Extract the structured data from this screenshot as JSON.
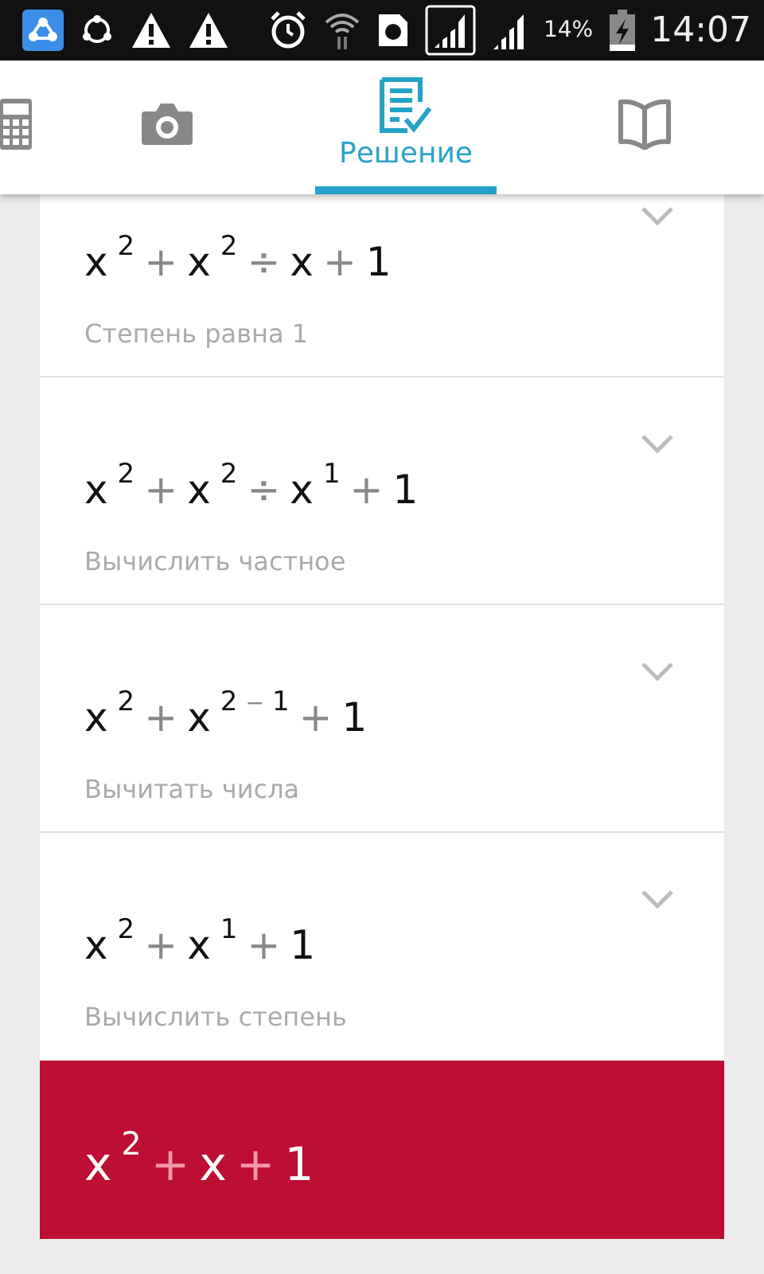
{
  "status_bar": {
    "battery": "14%",
    "time": "14:07"
  },
  "tabs": [
    {
      "kind": "calculator",
      "selected": false
    },
    {
      "kind": "camera",
      "selected": false
    },
    {
      "kind": "solution",
      "label": "Решение",
      "selected": true
    },
    {
      "kind": "book",
      "selected": false
    }
  ],
  "steps": [
    {
      "expression": [
        {
          "kind": "base",
          "text": "x"
        },
        {
          "kind": "sup",
          "tokens": [
            {
              "kind": "num",
              "text": "2"
            }
          ]
        },
        {
          "kind": "op",
          "text": "+"
        },
        {
          "kind": "base",
          "text": "x"
        },
        {
          "kind": "sup",
          "tokens": [
            {
              "kind": "num",
              "text": "2"
            }
          ]
        },
        {
          "kind": "op",
          "text": "÷"
        },
        {
          "kind": "base",
          "text": "x"
        },
        {
          "kind": "op",
          "text": "+"
        },
        {
          "kind": "base",
          "text": "1"
        }
      ],
      "caption": "Степень равна 1"
    },
    {
      "expression": [
        {
          "kind": "base",
          "text": "x"
        },
        {
          "kind": "sup",
          "tokens": [
            {
              "kind": "num",
              "text": "2"
            }
          ]
        },
        {
          "kind": "op",
          "text": "+"
        },
        {
          "kind": "base",
          "text": "x"
        },
        {
          "kind": "sup",
          "tokens": [
            {
              "kind": "num",
              "text": "2"
            }
          ]
        },
        {
          "kind": "op",
          "text": "÷"
        },
        {
          "kind": "base",
          "text": "x"
        },
        {
          "kind": "sup",
          "tokens": [
            {
              "kind": "num",
              "text": "1"
            }
          ]
        },
        {
          "kind": "op",
          "text": "+"
        },
        {
          "kind": "base",
          "text": "1"
        }
      ],
      "caption": "Вычислить частное"
    },
    {
      "expression": [
        {
          "kind": "base",
          "text": "x"
        },
        {
          "kind": "sup",
          "tokens": [
            {
              "kind": "num",
              "text": "2"
            }
          ]
        },
        {
          "kind": "op",
          "text": "+"
        },
        {
          "kind": "base",
          "text": "x"
        },
        {
          "kind": "sup",
          "tokens": [
            {
              "kind": "num",
              "text": "2"
            },
            {
              "kind": "op",
              "text": "−"
            },
            {
              "kind": "num",
              "text": "1"
            }
          ]
        },
        {
          "kind": "op",
          "text": "+"
        },
        {
          "kind": "base",
          "text": "1"
        }
      ],
      "caption": "Вычитать числа"
    },
    {
      "expression": [
        {
          "kind": "base",
          "text": "x"
        },
        {
          "kind": "sup",
          "tokens": [
            {
              "kind": "num",
              "text": "2"
            }
          ]
        },
        {
          "kind": "op",
          "text": "+"
        },
        {
          "kind": "base",
          "text": "x"
        },
        {
          "kind": "sup",
          "tokens": [
            {
              "kind": "num",
              "text": "1"
            }
          ]
        },
        {
          "kind": "op",
          "text": "+"
        },
        {
          "kind": "base",
          "text": "1"
        }
      ],
      "caption": "Вычислить степень"
    }
  ],
  "result": {
    "expression": [
      {
        "kind": "base",
        "text": "x"
      },
      {
        "kind": "sup",
        "tokens": [
          {
            "kind": "num",
            "text": "2"
          }
        ]
      },
      {
        "kind": "op",
        "text": "+"
      },
      {
        "kind": "base",
        "text": "x"
      },
      {
        "kind": "op",
        "text": "+"
      },
      {
        "kind": "base",
        "text": "1"
      }
    ]
  }
}
